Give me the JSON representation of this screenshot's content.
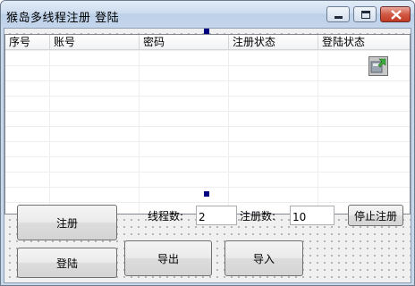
{
  "window": {
    "title": "猴岛多线程注册 登陆"
  },
  "table": {
    "columns": [
      "序号",
      "账号",
      "密码",
      "注册状态",
      "登陆状态"
    ],
    "rows": []
  },
  "buttons": {
    "register": "注册",
    "login": "登陆",
    "export": "导出",
    "import": "导入",
    "stop_register": "停止注册"
  },
  "fields": {
    "thread_count_label": "线程数:",
    "thread_count_value": "2",
    "register_count_label": "注册数:",
    "register_count_value": "10"
  },
  "icons": [
    "minimize-icon",
    "maximize-icon",
    "close-icon",
    "list-handle-icon"
  ]
}
